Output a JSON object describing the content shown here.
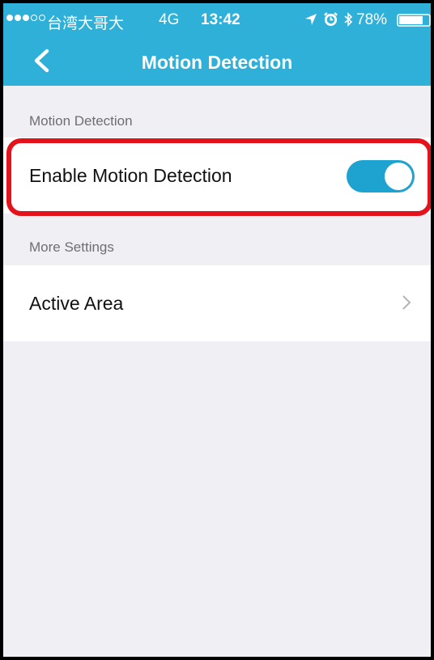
{
  "status_bar": {
    "carrier": "台湾大哥大",
    "network": "4G",
    "time": "13:42",
    "battery": "78%",
    "signal_bars": 3,
    "signal_max": 5,
    "icons": [
      "location-arrow-icon",
      "alarm-clock-icon",
      "bluetooth-icon",
      "battery-icon"
    ]
  },
  "nav": {
    "title": "Motion Detection",
    "back_icon": "chevron-left-icon"
  },
  "sections": [
    {
      "header": "Motion Detection",
      "rows": [
        {
          "label": "Enable Motion Detection",
          "control": "toggle",
          "toggle_on": true
        }
      ]
    },
    {
      "header": "More Settings",
      "rows": [
        {
          "label": "Active Area",
          "control": "chevron-right-icon"
        }
      ]
    }
  ],
  "colors": {
    "header": "#2fb0d8",
    "toggle_on": "#1ea2cf",
    "highlight": "#e4131b",
    "background": "#efeff4"
  }
}
